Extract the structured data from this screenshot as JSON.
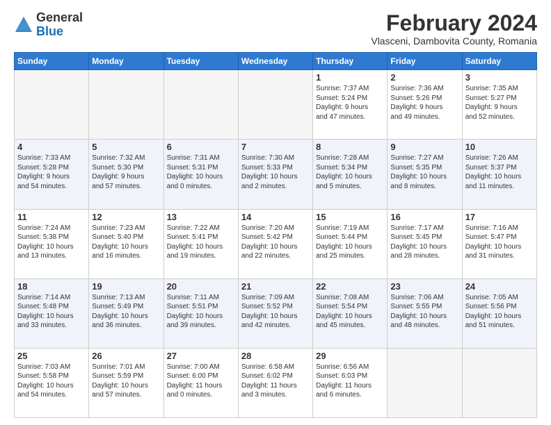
{
  "header": {
    "logo_general": "General",
    "logo_blue": "Blue",
    "title": "February 2024",
    "location": "Vlasceni, Dambovita County, Romania"
  },
  "days_of_week": [
    "Sunday",
    "Monday",
    "Tuesday",
    "Wednesday",
    "Thursday",
    "Friday",
    "Saturday"
  ],
  "weeks": [
    [
      {
        "day": "",
        "info": ""
      },
      {
        "day": "",
        "info": ""
      },
      {
        "day": "",
        "info": ""
      },
      {
        "day": "",
        "info": ""
      },
      {
        "day": "1",
        "info": "Sunrise: 7:37 AM\nSunset: 5:24 PM\nDaylight: 9 hours\nand 47 minutes."
      },
      {
        "day": "2",
        "info": "Sunrise: 7:36 AM\nSunset: 5:26 PM\nDaylight: 9 hours\nand 49 minutes."
      },
      {
        "day": "3",
        "info": "Sunrise: 7:35 AM\nSunset: 5:27 PM\nDaylight: 9 hours\nand 52 minutes."
      }
    ],
    [
      {
        "day": "4",
        "info": "Sunrise: 7:33 AM\nSunset: 5:28 PM\nDaylight: 9 hours\nand 54 minutes."
      },
      {
        "day": "5",
        "info": "Sunrise: 7:32 AM\nSunset: 5:30 PM\nDaylight: 9 hours\nand 57 minutes."
      },
      {
        "day": "6",
        "info": "Sunrise: 7:31 AM\nSunset: 5:31 PM\nDaylight: 10 hours\nand 0 minutes."
      },
      {
        "day": "7",
        "info": "Sunrise: 7:30 AM\nSunset: 5:33 PM\nDaylight: 10 hours\nand 2 minutes."
      },
      {
        "day": "8",
        "info": "Sunrise: 7:28 AM\nSunset: 5:34 PM\nDaylight: 10 hours\nand 5 minutes."
      },
      {
        "day": "9",
        "info": "Sunrise: 7:27 AM\nSunset: 5:35 PM\nDaylight: 10 hours\nand 8 minutes."
      },
      {
        "day": "10",
        "info": "Sunrise: 7:26 AM\nSunset: 5:37 PM\nDaylight: 10 hours\nand 11 minutes."
      }
    ],
    [
      {
        "day": "11",
        "info": "Sunrise: 7:24 AM\nSunset: 5:38 PM\nDaylight: 10 hours\nand 13 minutes."
      },
      {
        "day": "12",
        "info": "Sunrise: 7:23 AM\nSunset: 5:40 PM\nDaylight: 10 hours\nand 16 minutes."
      },
      {
        "day": "13",
        "info": "Sunrise: 7:22 AM\nSunset: 5:41 PM\nDaylight: 10 hours\nand 19 minutes."
      },
      {
        "day": "14",
        "info": "Sunrise: 7:20 AM\nSunset: 5:42 PM\nDaylight: 10 hours\nand 22 minutes."
      },
      {
        "day": "15",
        "info": "Sunrise: 7:19 AM\nSunset: 5:44 PM\nDaylight: 10 hours\nand 25 minutes."
      },
      {
        "day": "16",
        "info": "Sunrise: 7:17 AM\nSunset: 5:45 PM\nDaylight: 10 hours\nand 28 minutes."
      },
      {
        "day": "17",
        "info": "Sunrise: 7:16 AM\nSunset: 5:47 PM\nDaylight: 10 hours\nand 31 minutes."
      }
    ],
    [
      {
        "day": "18",
        "info": "Sunrise: 7:14 AM\nSunset: 5:48 PM\nDaylight: 10 hours\nand 33 minutes."
      },
      {
        "day": "19",
        "info": "Sunrise: 7:13 AM\nSunset: 5:49 PM\nDaylight: 10 hours\nand 36 minutes."
      },
      {
        "day": "20",
        "info": "Sunrise: 7:11 AM\nSunset: 5:51 PM\nDaylight: 10 hours\nand 39 minutes."
      },
      {
        "day": "21",
        "info": "Sunrise: 7:09 AM\nSunset: 5:52 PM\nDaylight: 10 hours\nand 42 minutes."
      },
      {
        "day": "22",
        "info": "Sunrise: 7:08 AM\nSunset: 5:54 PM\nDaylight: 10 hours\nand 45 minutes."
      },
      {
        "day": "23",
        "info": "Sunrise: 7:06 AM\nSunset: 5:55 PM\nDaylight: 10 hours\nand 48 minutes."
      },
      {
        "day": "24",
        "info": "Sunrise: 7:05 AM\nSunset: 5:56 PM\nDaylight: 10 hours\nand 51 minutes."
      }
    ],
    [
      {
        "day": "25",
        "info": "Sunrise: 7:03 AM\nSunset: 5:58 PM\nDaylight: 10 hours\nand 54 minutes."
      },
      {
        "day": "26",
        "info": "Sunrise: 7:01 AM\nSunset: 5:59 PM\nDaylight: 10 hours\nand 57 minutes."
      },
      {
        "day": "27",
        "info": "Sunrise: 7:00 AM\nSunset: 6:00 PM\nDaylight: 11 hours\nand 0 minutes."
      },
      {
        "day": "28",
        "info": "Sunrise: 6:58 AM\nSunset: 6:02 PM\nDaylight: 11 hours\nand 3 minutes."
      },
      {
        "day": "29",
        "info": "Sunrise: 6:56 AM\nSunset: 6:03 PM\nDaylight: 11 hours\nand 6 minutes."
      },
      {
        "day": "",
        "info": ""
      },
      {
        "day": "",
        "info": ""
      }
    ]
  ]
}
